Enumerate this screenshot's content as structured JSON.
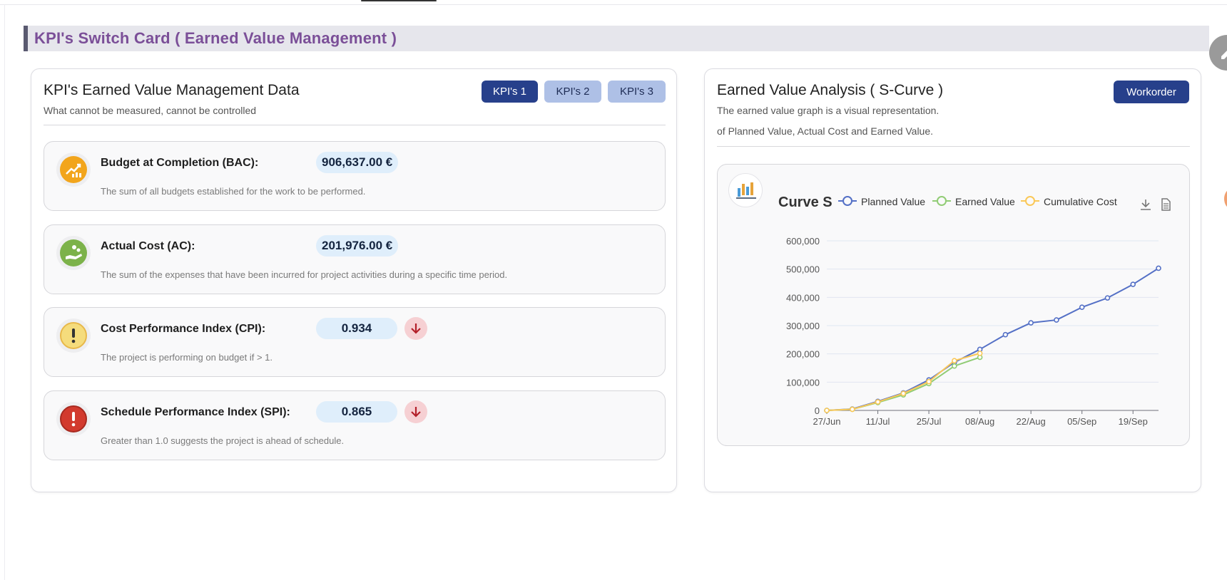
{
  "section": {
    "title": "KPI's Switch Card ( Earned Value Management )"
  },
  "left_card": {
    "title": "KPI's Earned Value Management Data",
    "subtitle": "What cannot be measured, cannot be controlled",
    "tabs": [
      {
        "label": "KPI's 1",
        "active": true
      },
      {
        "label": "KPI's 2",
        "active": false
      },
      {
        "label": "KPI's 3",
        "active": false
      }
    ],
    "kpis": [
      {
        "icon": "rising-chart-icon",
        "color": "#f2a51c",
        "label": "Budget at Completion (BAC):",
        "value": "906,637.00 €",
        "description": "The sum of all budgets established for the work to be performed.",
        "trend": ""
      },
      {
        "icon": "hand-coins-icon",
        "color": "#7cb24a",
        "label": "Actual Cost (AC):",
        "value": "201,976.00 €",
        "description": "The sum of the expenses that have been incurred for project activities during a specific time period.",
        "trend": ""
      },
      {
        "icon": "warning-icon",
        "color": "#f5dc7c",
        "label": "Cost Performance Index (CPI):",
        "value": "0.934",
        "description": "The project is performing on budget if > 1.",
        "trend": "down"
      },
      {
        "icon": "alert-icon",
        "color": "#d23a2e",
        "label": "Schedule Performance Index (SPI):",
        "value": "0.865",
        "description": "Greater than 1.0 suggests the project is ahead of schedule.",
        "trend": "down"
      }
    ]
  },
  "right_card": {
    "title": "Earned Value Analysis ( S-Curve )",
    "subtitle_line1": "The earned value graph is a visual representation.",
    "subtitle_line2": "of Planned Value, Actual Cost and Earned Value.",
    "workorder_button": "Workorder"
  },
  "colors": {
    "planned": "#5470c6",
    "earned": "#91cc75",
    "cost": "#fac858",
    "primary": "#27408b",
    "title": "#7b4f98"
  },
  "chart_data": {
    "type": "line",
    "title": "Curve S",
    "x": [
      "27/Jun",
      "04/Jul",
      "11/Jul",
      "18/Jul",
      "25/Jul",
      "01/Aug",
      "08/Aug",
      "15/Aug",
      "22/Aug",
      "29/Aug",
      "05/Sep",
      "12/Sep",
      "19/Sep",
      "26/Sep"
    ],
    "x_tick_labels": [
      "27/Jun",
      "11/Jul",
      "25/Jul",
      "08/Aug",
      "22/Aug",
      "05/Sep",
      "19/Sep"
    ],
    "y_tick_labels": [
      "0",
      "100,000",
      "200,000",
      "300,000",
      "400,000",
      "500,000",
      "600,000"
    ],
    "ylim": [
      0,
      600000
    ],
    "grid": true,
    "legend_position": "top",
    "series": [
      {
        "name": "Planned Value",
        "color": "#5470c6",
        "values": [
          0,
          5000,
          32000,
          62000,
          108000,
          170000,
          216000,
          268000,
          310000,
          320000,
          365000,
          398000,
          446000,
          503000
        ]
      },
      {
        "name": "Earned Value",
        "color": "#91cc75",
        "values": [
          0,
          4000,
          28000,
          55000,
          95000,
          157000,
          188000
        ]
      },
      {
        "name": "Cumulative Cost",
        "color": "#fac858",
        "values": [
          0,
          4000,
          30000,
          60000,
          102000,
          176000,
          201976
        ]
      }
    ]
  }
}
